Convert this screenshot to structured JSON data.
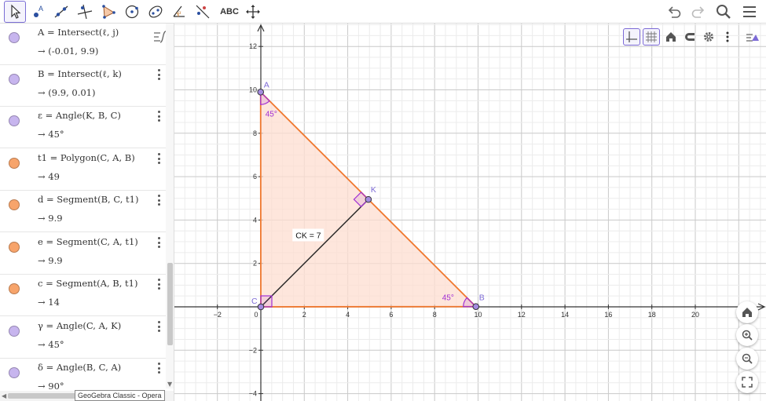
{
  "toolbar": {
    "tools": [
      {
        "name": "move-tool",
        "icon": "cursor-arrow-icon"
      },
      {
        "name": "point-tool",
        "icon": "point-icon"
      },
      {
        "name": "line-tool",
        "icon": "line-icon"
      },
      {
        "name": "perpendicular-line-tool",
        "icon": "perpendicular-icon"
      },
      {
        "name": "polygon-tool",
        "icon": "polygon-icon"
      },
      {
        "name": "circle-tool",
        "icon": "circle-icon"
      },
      {
        "name": "conic-tool",
        "icon": "ellipse-icon"
      },
      {
        "name": "angle-tool",
        "icon": "angle-icon"
      },
      {
        "name": "reflect-tool",
        "icon": "reflect-icon"
      },
      {
        "name": "text-tool",
        "icon": "text-icon"
      },
      {
        "name": "move-graphics-tool",
        "icon": "move-view-icon"
      }
    ],
    "text_tool_label": "ABC",
    "right": [
      "undo-icon",
      "redo-icon",
      "search-icon",
      "menu-icon"
    ]
  },
  "colors": {
    "accent": "#7d6bd6",
    "point_fill": "#a48be0",
    "polygon_stroke": "#f07930",
    "polygon_fill": "#fdded0",
    "angle_color": "#a230d4",
    "segment_dark": "#222222",
    "purple_dot": "#c7b5ee",
    "orange_dot": "#f7a46b"
  },
  "algebra": {
    "rows": [
      {
        "dot": "purple",
        "expr": "A = Intersect(ℓ, j)",
        "value": "→  (-0.01, 9.9)"
      },
      {
        "dot": "purple",
        "expr": "B = Intersect(ℓ, k)",
        "value": "→  (9.9, 0.01)"
      },
      {
        "dot": "purple",
        "expr": "ε = Angle(K, B, C)",
        "value": "→  45°"
      },
      {
        "dot": "orange",
        "expr": "t1 = Polygon(C, A, B)",
        "value": "→  49"
      },
      {
        "dot": "orange",
        "expr": "d = Segment(B, C, t1)",
        "value": "→  9.9"
      },
      {
        "dot": "orange",
        "expr": "e = Segment(C, A, t1)",
        "value": "→  9.9"
      },
      {
        "dot": "orange",
        "expr": "c = Segment(A, B, t1)",
        "value": "→  14"
      },
      {
        "dot": "purple",
        "expr": "γ = Angle(C, A, K)",
        "value": "→  45°"
      },
      {
        "dot": "purple",
        "expr": "δ = Angle(B, C, A)",
        "value": "→  90°"
      }
    ],
    "tooltip": "GeoGebra Classic - Opera"
  },
  "graphics": {
    "x_ticks": [
      "−2",
      "0",
      "2",
      "4",
      "6",
      "8",
      "10",
      "12",
      "14",
      "16",
      "18",
      "20"
    ],
    "y_ticks": [
      "12",
      "10",
      "8",
      "6",
      "4",
      "2",
      "−2",
      "−4"
    ],
    "x_values": [
      -2,
      0,
      2,
      4,
      6,
      8,
      10,
      12,
      14,
      16,
      18,
      20
    ],
    "y_values": [
      12,
      10,
      8,
      6,
      4,
      2,
      -2,
      -4
    ],
    "points": [
      {
        "label": "A",
        "x": -0.01,
        "y": 9.9
      },
      {
        "label": "B",
        "x": 9.9,
        "y": 0.01
      },
      {
        "label": "C",
        "x": 0,
        "y": 0
      },
      {
        "label": "K",
        "x": 4.95,
        "y": 4.95
      }
    ],
    "angle_labels": {
      "A": "45°",
      "B": "45°"
    },
    "ck_label": "CK = 7",
    "style_tools": [
      "axes-icon",
      "grid-icon",
      "home-icon",
      "magnet-icon",
      "gear-icon",
      "more-icon",
      "style-bar-icon"
    ],
    "zoom_buttons": [
      "home-icon",
      "zoom-in-icon",
      "zoom-out-icon",
      "fullscreen-icon"
    ]
  }
}
